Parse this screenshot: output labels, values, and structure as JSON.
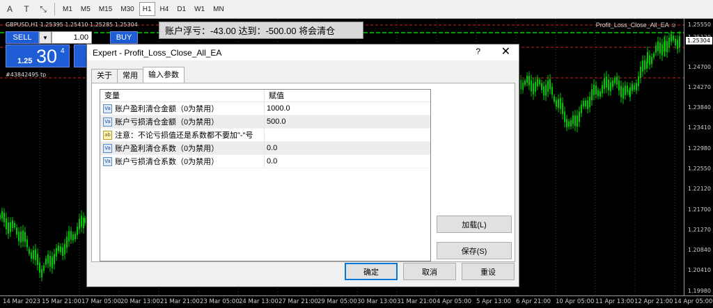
{
  "toolbar": {
    "tools": [
      {
        "icon": "text-tool-icon",
        "glyph": "A"
      },
      {
        "icon": "text-label-tool-icon",
        "glyph": "T"
      },
      {
        "icon": "arrows-tool-icon",
        "glyph": "⤡"
      }
    ],
    "timeframes": [
      "M1",
      "M5",
      "M15",
      "M30",
      "H1",
      "H4",
      "D1",
      "W1",
      "MN"
    ],
    "active_timeframe": "H1"
  },
  "chart": {
    "symbol_info": "GBPUSD,H1  1.25395 1.25410 1.25285 1.25304",
    "ea_name": "Profit_Loss_Close_All_EA ☺",
    "pl_message": "账户浮亏：-43.00 达到：-500.00 将会清仓",
    "order_tag": "#43842495 tp",
    "current_price": "1.25304",
    "price_ticks": [
      "1.25550",
      "1.25120",
      "1.24700",
      "1.24270",
      "1.23840",
      "1.23410",
      "1.22980",
      "1.22550",
      "1.22120",
      "1.21700",
      "1.21270",
      "1.20840",
      "1.20410",
      "1.19980"
    ],
    "time_ticks": [
      "14 Mar 2023",
      "15 Mar 21:00",
      "17 Mar 05:00",
      "20 Mar 13:00",
      "21 Mar 21:00",
      "23 Mar 05:00",
      "24 Mar 13:00",
      "27 Mar 21:00",
      "29 Mar 05:00",
      "30 Mar 13:00",
      "31 Mar 21:00",
      "4 Apr 05:00",
      "5 Apr 13:00",
      "6 Apr 21:00",
      "10 Apr 05:00",
      "11 Apr 13:00",
      "12 Apr 21:00",
      "14 Apr 05:00"
    ],
    "colors": {
      "candle": "#00c800",
      "grid": "#3a3a3a",
      "sl_line": "#d02020",
      "tp_line": "#00a000"
    }
  },
  "one_click": {
    "sell_label": "SELL",
    "buy_label": "BUY",
    "lot_value": "1.00",
    "dropdown_glyph": "▼",
    "price_prefix": "1.25",
    "price_big": "30",
    "price_sup": "4"
  },
  "dialog": {
    "title": "Expert - Profit_Loss_Close_All_EA",
    "help_glyph": "?",
    "close_glyph": "✕",
    "tabs": [
      "关于",
      "常用",
      "输入参数"
    ],
    "active_tab": "输入参数",
    "grid": {
      "col_variable": "变量",
      "col_value": "赋值",
      "rows": [
        {
          "icon": "Va",
          "name": "账户盈利清仓金额（0为禁用）",
          "value": "1000.0"
        },
        {
          "icon": "Va",
          "name": "账户亏损清仓金额（0为禁用）",
          "value": "500.0"
        },
        {
          "icon": "ab",
          "name": "注意：不论亏损值还是系数都不要加\"-\"号",
          "value": ""
        },
        {
          "icon": "Va",
          "name": "账户盈利清仓系数（0为禁用）",
          "value": "0.0"
        },
        {
          "icon": "Va",
          "name": "账户亏损清仓系数（0为禁用）",
          "value": "0.0"
        }
      ]
    },
    "load_label": "加载(L)",
    "save_label": "保存(S)",
    "ok_label": "确定",
    "cancel_label": "取消",
    "reset_label": "重设"
  }
}
